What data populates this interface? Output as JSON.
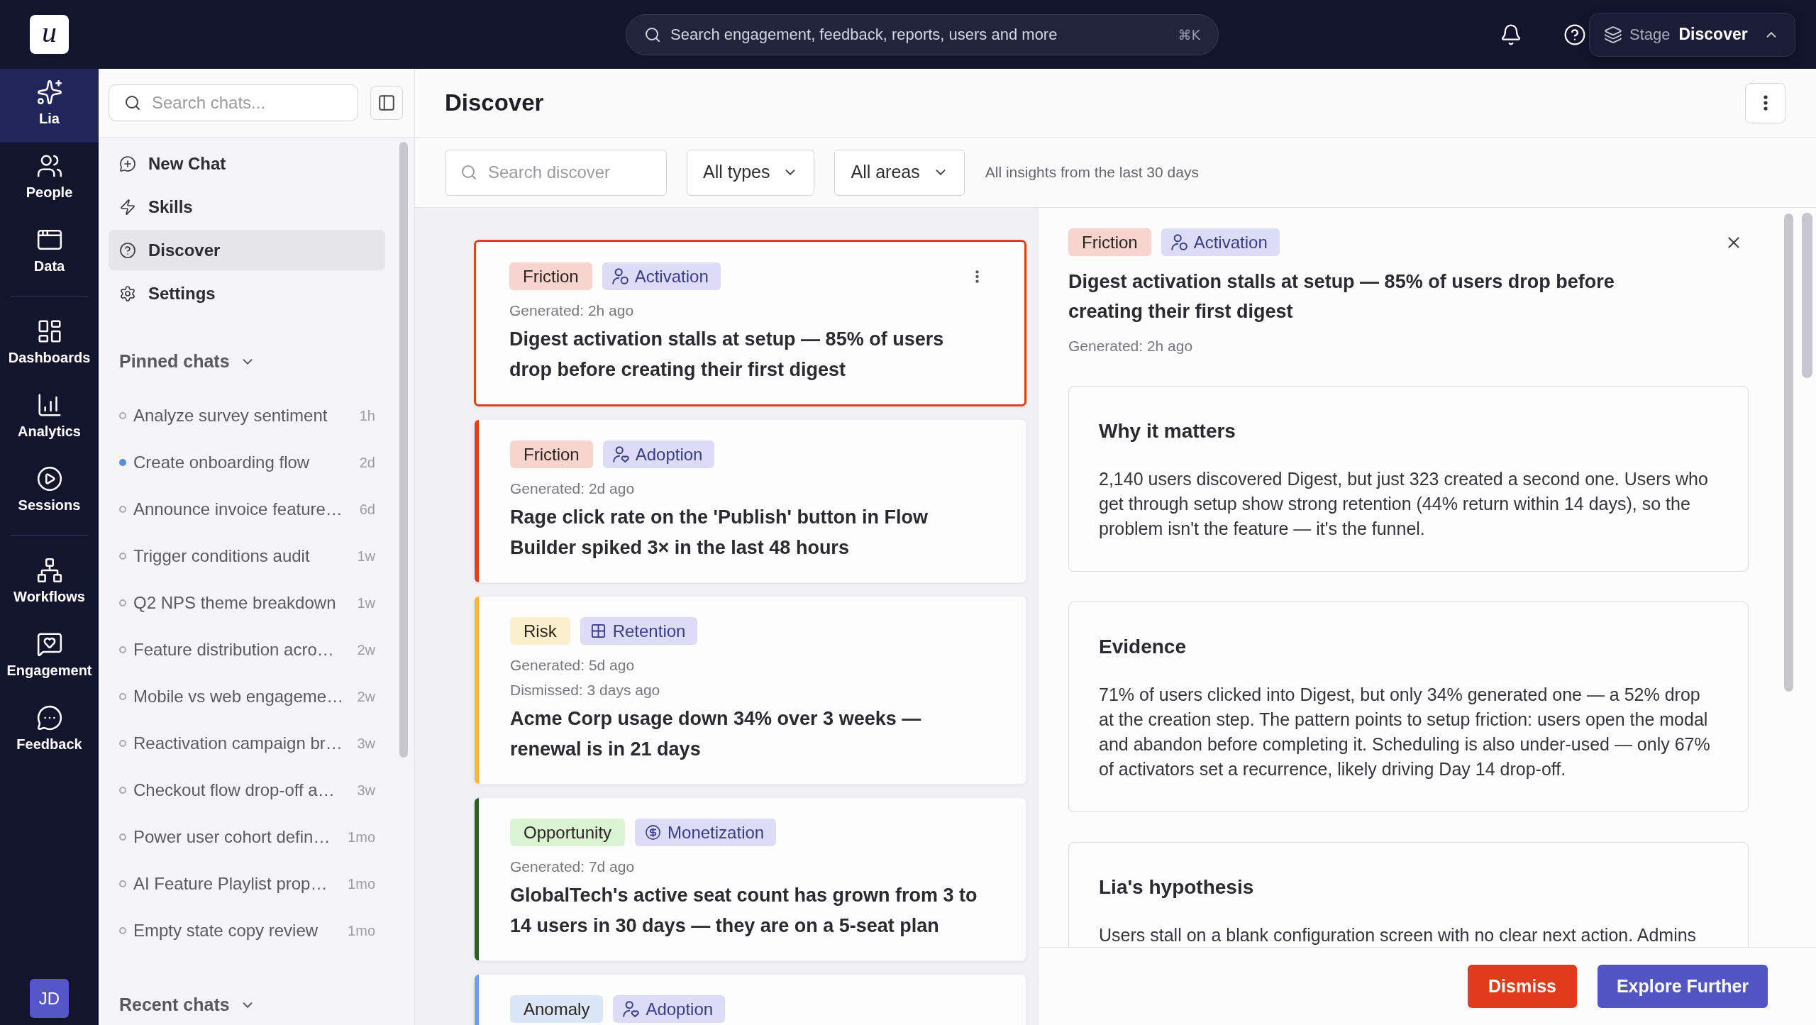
{
  "logo": "u",
  "topbar": {
    "search": {
      "placeholder": "Search engagement, feedback, reports, users and more",
      "shortcut": "⌘K"
    },
    "stage": {
      "label": "Stage",
      "value": "Discover"
    }
  },
  "nav_rail": {
    "groups": [
      [
        {
          "label": "Lia",
          "selected": true
        },
        {
          "label": "People",
          "selected": false
        },
        {
          "label": "Data",
          "selected": false
        }
      ],
      [
        {
          "label": "Dashboards",
          "selected": false
        },
        {
          "label": "Analytics",
          "selected": false
        },
        {
          "label": "Sessions",
          "selected": false
        }
      ],
      [
        {
          "label": "Workflows",
          "selected": false
        },
        {
          "label": "Engagement",
          "selected": false
        },
        {
          "label": "Feedback",
          "selected": false
        }
      ]
    ],
    "avatar": "JD"
  },
  "sidebar": {
    "search": {
      "placeholder": "Search chats..."
    },
    "nav": [
      {
        "label": "New Chat",
        "selected": false
      },
      {
        "label": "Skills",
        "selected": false
      },
      {
        "label": "Discover",
        "selected": true
      },
      {
        "label": "Settings",
        "selected": false
      }
    ],
    "pinned": {
      "title": "Pinned chats",
      "expanded": true,
      "chats": [
        {
          "title": "Analyze survey sentiment",
          "time": "1h",
          "unread": false
        },
        {
          "title": "Create onboarding flow",
          "time": "2d",
          "unread": true
        },
        {
          "title": "Announce invoice feature…",
          "time": "6d",
          "unread": false
        },
        {
          "title": "Trigger conditions audit",
          "time": "1w",
          "unread": false
        },
        {
          "title": "Q2 NPS theme breakdown",
          "time": "1w",
          "unread": false
        },
        {
          "title": "Feature distribution acro…",
          "time": "2w",
          "unread": false
        },
        {
          "title": "Mobile vs web engageme…",
          "time": "2w",
          "unread": false
        },
        {
          "title": "Reactivation campaign br…",
          "time": "3w",
          "unread": false
        },
        {
          "title": "Checkout flow drop-off a…",
          "time": "3w",
          "unread": false
        },
        {
          "title": "Power user cohort defin…",
          "time": "1mo",
          "unread": false
        },
        {
          "title": "AI Feature Playlist prop…",
          "time": "1mo",
          "unread": false
        },
        {
          "title": "Empty state copy review",
          "time": "1mo",
          "unread": false
        }
      ]
    },
    "recent": {
      "title": "Recent chats",
      "expanded": true
    }
  },
  "page": {
    "title": "Discover",
    "filters": {
      "search": {
        "placeholder": "Search discover"
      },
      "dropdowns": [
        "All types",
        "All areas"
      ],
      "note": "All insights from the last 30 days"
    }
  },
  "insights": [
    {
      "selected": true,
      "color": "#e0401f",
      "category": {
        "label": "Friction",
        "color": "#f7d4ce"
      },
      "area": {
        "kind": "activation",
        "label": "Activation"
      },
      "generated": "Generated: 2h ago",
      "title": "Digest activation stalls at setup — 85% of users drop before creating their first digest"
    },
    {
      "selected": false,
      "color": "#e0401f",
      "category": {
        "label": "Friction",
        "color": "#f7d4ce"
      },
      "area": {
        "kind": "adoption",
        "label": "Adoption"
      },
      "generated": "Generated: 2d ago",
      "title": "Rage click rate on the 'Publish' button in Flow Builder spiked 3× in the last 48 hours"
    },
    {
      "selected": false,
      "color": "#f5b83d",
      "category": {
        "label": "Risk",
        "color": "#fcf0cc"
      },
      "area": {
        "kind": "retention",
        "label": "Retention"
      },
      "generated": "Generated: 5d ago",
      "dismissed": "Dismissed: 3 days ago",
      "title": "Acme Corp usage down 34% over 3 weeks — renewal is in 21 days"
    },
    {
      "selected": false,
      "color": "#2c5e26",
      "category": {
        "label": "Opportunity",
        "color": "#d9f3d3"
      },
      "area": {
        "kind": "monetization",
        "label": "Monetization"
      },
      "generated": "Generated: 7d ago",
      "title": "GlobalTech's active seat count has grown from 3 to 14 users in 30 days — they are on a 5-seat plan"
    },
    {
      "selected": false,
      "color": "#6f9ee6",
      "category": {
        "label": "Anomaly",
        "color": "#dbe6f7"
      },
      "area": {
        "kind": "adoption",
        "label": "Adoption"
      }
    }
  ],
  "detail": {
    "category": {
      "label": "Friction",
      "color": "#f7d4ce"
    },
    "area": {
      "kind": "activation",
      "label": "Activation"
    },
    "title": "Digest activation stalls at setup — 85% of users drop before creating their first digest",
    "generated": "Generated: 2h ago",
    "sections": [
      {
        "title": "Why it matters",
        "body": "2,140 users discovered Digest, but just 323 created a second one. Users who get through setup show strong retention (44% return within 14 days), so the problem isn't the feature — it's the funnel."
      },
      {
        "title": "Evidence",
        "body": "71% of users clicked into Digest, but only 34% generated one — a 52% drop at the creation step. The pattern points to setup friction: users open the modal and abandon before completing it. Scheduling is also under-used — only 67% of activators set a recurrence, likely driving Day 14 drop-off."
      },
      {
        "title": "Lia's hypothesis",
        "body": "Users stall on a blank configuration screen with no clear next action. Admins"
      }
    ],
    "actions": [
      {
        "label": "Dismiss",
        "kind": "danger"
      },
      {
        "label": "Explore Further",
        "kind": "primary"
      }
    ]
  }
}
